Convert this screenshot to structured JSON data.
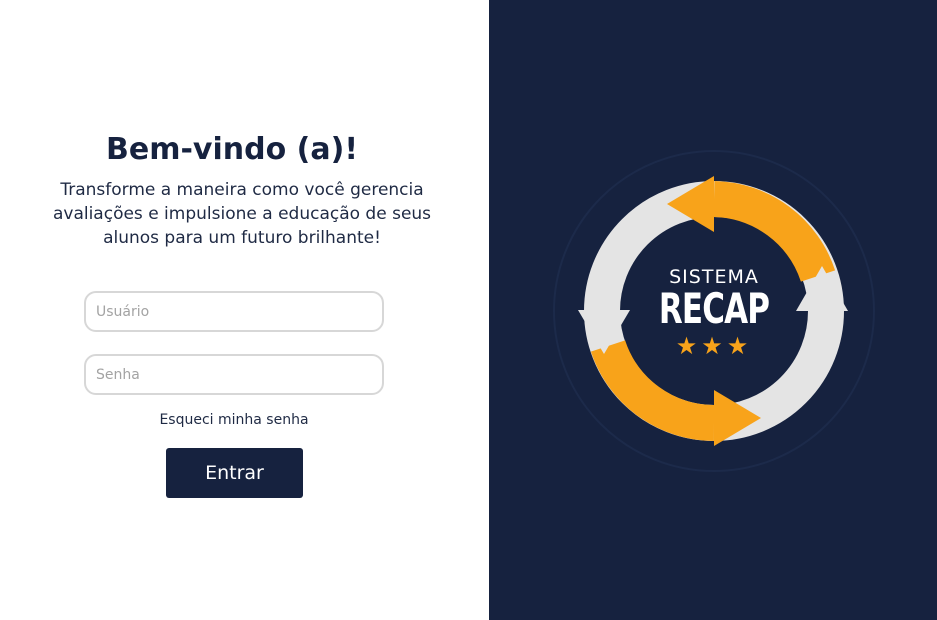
{
  "login": {
    "title": "Bem-vindo (a)!",
    "subtitle": "Transforme a maneira como você gerencia avaliações e impulsione a educação de seus alunos para um futuro brilhante!",
    "username_placeholder": "Usuário",
    "password_placeholder": "Senha",
    "forgot_link": "Esqueci minha senha",
    "submit_label": "Entrar"
  },
  "logo": {
    "line1": "SISTEMA",
    "line2": "RECAP",
    "stars": "★★★",
    "icon": "recycle-arrows-icon"
  },
  "colors": {
    "navy": "#16223f",
    "orange": "#f8a31a",
    "light_gray": "#e4e4e4"
  }
}
